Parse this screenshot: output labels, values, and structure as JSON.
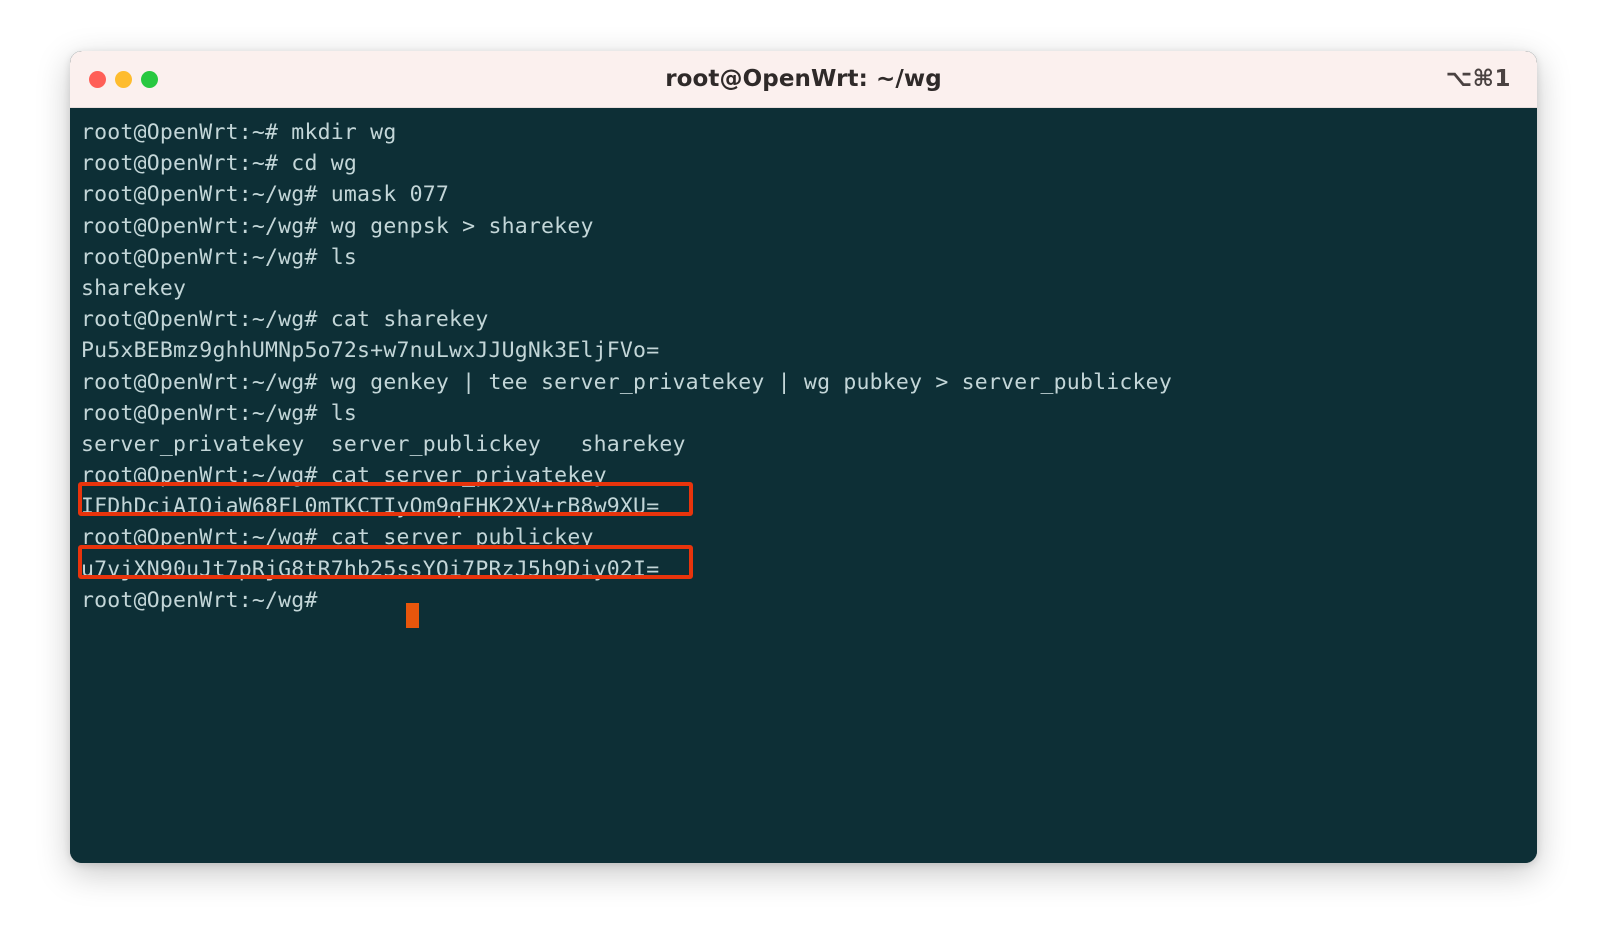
{
  "window": {
    "title": "root@OpenWrt: ~/wg",
    "shortcut": "⌥⌘1",
    "controls": {
      "close": "close-button",
      "minimize": "minimize-button",
      "maximize": "maximize-button"
    }
  },
  "theme": {
    "titlebar_bg": "#fbf0ee",
    "terminal_bg": "#0d2f36",
    "terminal_fg": "#c3d6d8",
    "annotation": "#e8340c",
    "cursor": "#e8560c"
  },
  "terminal": {
    "lines": [
      "root@OpenWrt:~# mkdir wg",
      "root@OpenWrt:~# cd wg",
      "root@OpenWrt:~/wg# umask 077",
      "root@OpenWrt:~/wg# wg genpsk > sharekey",
      "root@OpenWrt:~/wg# ls",
      "sharekey",
      "root@OpenWrt:~/wg# cat sharekey",
      "Pu5xBEBmz9ghhUMNp5o72s+w7nuLwxJJUgNk3EljFVo=",
      "root@OpenWrt:~/wg# wg genkey | tee server_privatekey | wg pubkey > server_publickey",
      "root@OpenWrt:~/wg# ls",
      "server_privatekey  server_publickey   sharekey",
      "root@OpenWrt:~/wg# cat server_privatekey",
      "IFDhDciAIOiaW68FL0mTKCTIyQm9qFHK2XV+rB8w9XU=",
      "root@OpenWrt:~/wg# cat server_publickey",
      "u7vjXN90uJt7pRjG8tR7hb25ssYOi7PRzJ5h9Diy02I=",
      "root@OpenWrt:~/wg# "
    ]
  },
  "annotations": {
    "private_key_box": "server_privatekey value highlighted",
    "public_key_box": "server_publickey value highlighted"
  }
}
